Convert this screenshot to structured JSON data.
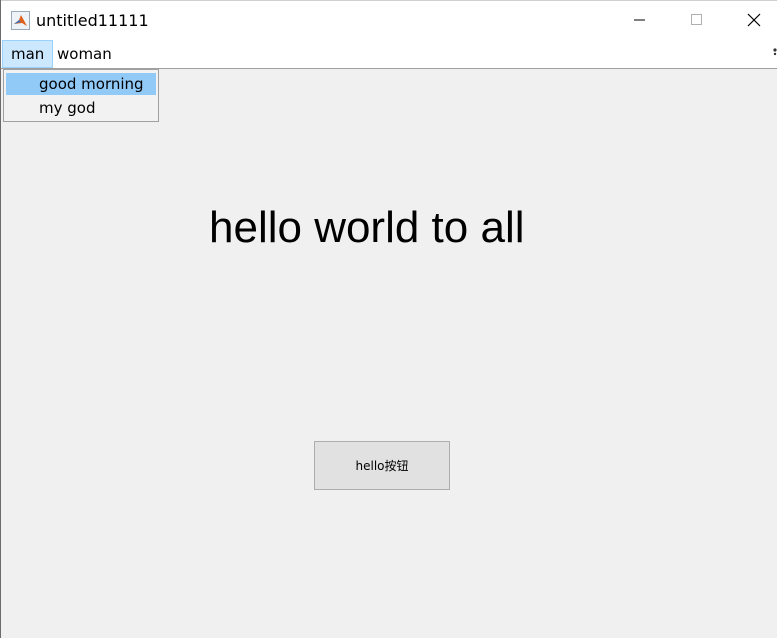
{
  "window": {
    "title": "untitled11111",
    "icon": "matlab-icon"
  },
  "menubar": {
    "items": [
      {
        "label": "man"
      },
      {
        "label": "woman"
      }
    ]
  },
  "dropdown": {
    "items": [
      {
        "label": "good morning",
        "selected": true
      },
      {
        "label": "my god",
        "selected": false
      }
    ]
  },
  "main": {
    "static_text": "hello world to all",
    "button_label": "hello按钮"
  },
  "colors": {
    "menu_active_bg": "#cce8ff",
    "dropdown_selected_bg": "#91c9f7",
    "figure_bg": "#f0f0f0"
  }
}
